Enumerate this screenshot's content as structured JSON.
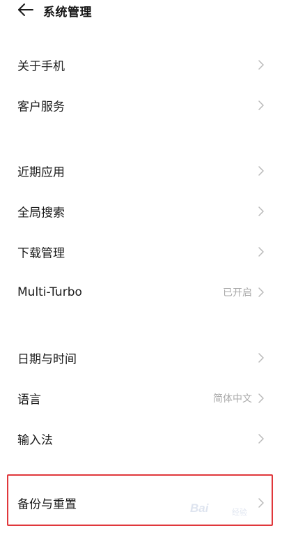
{
  "header": {
    "back_icon": "arrow-left-icon",
    "title": "系统管理"
  },
  "groups": [
    {
      "items": [
        {
          "label": "关于手机",
          "value": ""
        },
        {
          "label": "客户服务",
          "value": ""
        }
      ]
    },
    {
      "items": [
        {
          "label": "近期应用",
          "value": ""
        },
        {
          "label": "全局搜索",
          "value": ""
        },
        {
          "label": "下载管理",
          "value": ""
        },
        {
          "label": "Multi-Turbo",
          "value": "已开启"
        }
      ]
    },
    {
      "items": [
        {
          "label": "日期与时间",
          "value": ""
        },
        {
          "label": "语言",
          "value": "简体中文"
        },
        {
          "label": "输入法",
          "value": ""
        }
      ]
    },
    {
      "items": [
        {
          "label": "备份与重置",
          "value": ""
        }
      ]
    }
  ],
  "chevron_icon": "chevron-right-icon",
  "highlight_color": "#e0373b",
  "watermark": {
    "brand": "Bai",
    "sub": "经验"
  }
}
